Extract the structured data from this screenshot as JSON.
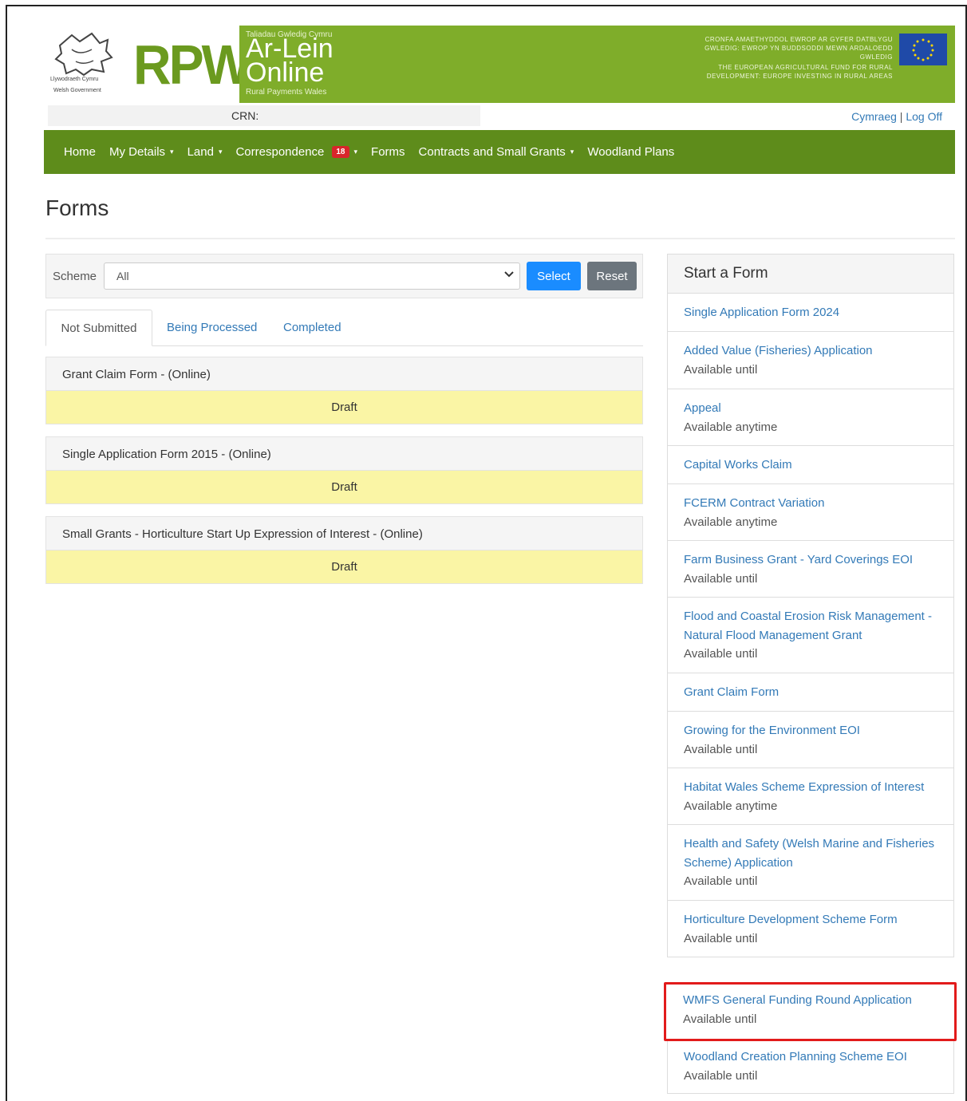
{
  "header": {
    "gov_name_line1": "Llywodraeth Cymru",
    "gov_name_line2": "Welsh Government",
    "rpw": "RPW",
    "small_top": "Taliadau Gwledig Cymru",
    "arlein_line1": "Ar-Lein",
    "arlein_line2": "Online",
    "rpw_sub": "Rural Payments Wales",
    "eu_text_cy": "CRONFA AMAETHYDDOL EWROP AR GYFER DATBLYGU GWLEDIG: EWROP YN BUDDSODDI MEWN ARDALOEDD GWLEDIG",
    "eu_text_en": "THE EUROPEAN AGRICULTURAL FUND FOR RURAL DEVELOPMENT: EUROPE INVESTING IN RURAL AREAS"
  },
  "crn": {
    "label": "CRN:",
    "cymraeg": "Cymraeg",
    "separator": "|",
    "logoff": "Log Off"
  },
  "nav": {
    "home": "Home",
    "my_details": "My Details",
    "land": "Land",
    "correspondence": "Correspondence",
    "correspondence_badge": "18",
    "forms": "Forms",
    "contracts": "Contracts and Small Grants",
    "woodland": "Woodland Plans",
    "caret": "▾"
  },
  "page": {
    "title": "Forms"
  },
  "scheme": {
    "label": "Scheme",
    "value": "All",
    "select_btn": "Select",
    "reset_btn": "Reset"
  },
  "tabs": {
    "not_submitted": "Not Submitted",
    "being_processed": "Being Processed",
    "completed": "Completed"
  },
  "drafts": [
    {
      "title": "Grant Claim Form - (Online)",
      "status": "Draft"
    },
    {
      "title": "Single Application Form 2015 - (Online)",
      "status": "Draft"
    },
    {
      "title": "Small Grants - Horticulture Start Up Expression of Interest - (Online)",
      "status": "Draft"
    }
  ],
  "start_form": {
    "heading": "Start a Form",
    "items": [
      {
        "name": "Single Application Form 2024",
        "avail": ""
      },
      {
        "name": "Added Value (Fisheries) Application",
        "avail": "Available until"
      },
      {
        "name": "Appeal",
        "avail": "Available anytime"
      },
      {
        "name": "Capital Works Claim",
        "avail": ""
      },
      {
        "name": "FCERM Contract Variation",
        "avail": "Available anytime"
      },
      {
        "name": "Farm Business Grant - Yard Coverings EOI",
        "avail": "Available until"
      },
      {
        "name": "Flood and Coastal Erosion Risk Management - Natural Flood Management Grant",
        "avail": "Available until"
      },
      {
        "name": "Grant Claim Form",
        "avail": ""
      },
      {
        "name": "Growing for the Environment EOI",
        "avail": "Available until"
      },
      {
        "name": "Habitat Wales Scheme Expression of Interest",
        "avail": "Available anytime"
      },
      {
        "name": "Health and Safety (Welsh Marine and Fisheries Scheme) Application",
        "avail": "Available until"
      },
      {
        "name": "Horticulture Development Scheme Form",
        "avail": "Available until"
      }
    ],
    "highlighted": {
      "name": "WMFS General Funding Round Application",
      "avail": "Available until"
    },
    "last": {
      "name": "Woodland Creation Planning Scheme EOI",
      "avail": "Available until"
    }
  },
  "colors": {
    "banner_green": "#7fad2a",
    "nav_green": "#5e8c1b",
    "link_blue": "#337ab7",
    "draft_yellow": "#faf5a5",
    "highlight_red": "#e21b1b"
  }
}
